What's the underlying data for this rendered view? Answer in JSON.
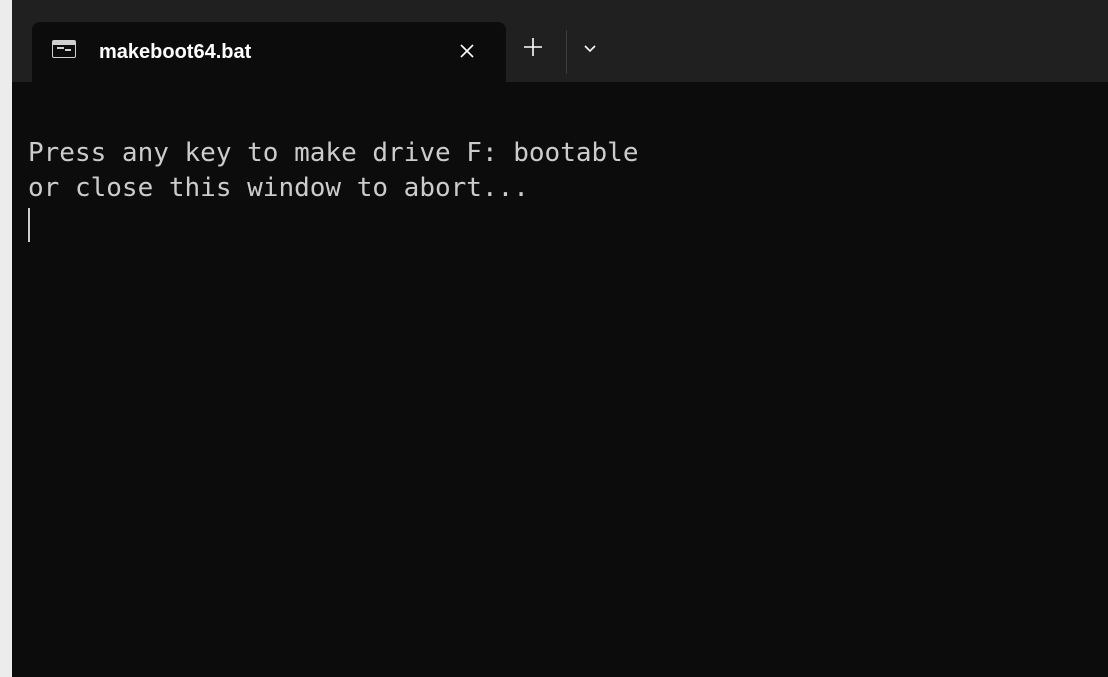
{
  "window": {
    "background": "#0c0c0c",
    "titlebar_background": "#202020"
  },
  "tab": {
    "title": "makeboot64.bat",
    "icon": "terminal-icon",
    "close_icon": "close-icon"
  },
  "toolbar": {
    "new_tab_icon": "plus-icon",
    "dropdown_icon": "chevron-down-icon"
  },
  "terminal": {
    "lines": [
      "Press any key to make drive F: bootable",
      "or close this window to abort..."
    ],
    "text_color": "#cccccc"
  }
}
